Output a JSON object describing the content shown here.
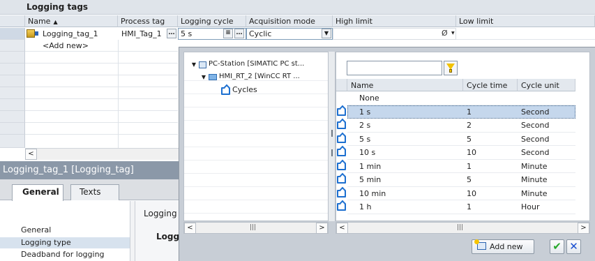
{
  "table": {
    "title": "Logging tags",
    "columns": [
      "Name",
      "Process tag",
      "Logging cycle",
      "Acquisition mode",
      "High limit",
      "Low limit"
    ],
    "rows": [
      {
        "name": "Logging_tag_1",
        "process_tag": "HMI_Tag_1",
        "logging_cycle": "5 s",
        "acquisition_mode": "Cyclic",
        "high_limit": "",
        "low_limit": ""
      }
    ],
    "add_new": "<Add new>",
    "ellipsis_glyph": "…",
    "list_glyph": "≡",
    "dropdown_glyph": "▼",
    "nolimit_glyph": "Ø"
  },
  "properties": {
    "title": "Logging_tag_1 [Logging_tag]",
    "tabs": [
      "General",
      "Texts"
    ],
    "nav": [
      "General",
      "Logging type",
      "Deadband for logging"
    ],
    "selected_nav": "Logging type",
    "content_heading": "Logging",
    "content_subheading": "Loggi"
  },
  "picker": {
    "tree": [
      {
        "label": "PC-Station [SIMATIC PC st...",
        "level": 0
      },
      {
        "label": "HMI_RT_2 [WinCC RT ...",
        "level": 1
      },
      {
        "label": "Cycles",
        "level": 2
      }
    ],
    "filter_value": "",
    "columns": [
      "Name",
      "Cycle time",
      "Cycle unit"
    ],
    "rows": [
      {
        "name": "None",
        "time": "",
        "unit": ""
      },
      {
        "name": "1 s",
        "time": "1",
        "unit": "Second"
      },
      {
        "name": "2 s",
        "time": "2",
        "unit": "Second"
      },
      {
        "name": "5 s",
        "time": "5",
        "unit": "Second"
      },
      {
        "name": "10 s",
        "time": "10",
        "unit": "Second"
      },
      {
        "name": "1 min",
        "time": "1",
        "unit": "Minute"
      },
      {
        "name": "5 min",
        "time": "5",
        "unit": "Minute"
      },
      {
        "name": "10 min",
        "time": "10",
        "unit": "Minute"
      },
      {
        "name": "1 h",
        "time": "1",
        "unit": "Hour"
      }
    ],
    "selected_row": "1 s",
    "add_new_label": "Add new",
    "ok_glyph": "✔",
    "cancel_glyph": "✕",
    "scroll_left_glyph": "<",
    "scroll_right_glyph": ">",
    "scroll_grip_glyph": "|||"
  },
  "colors": {
    "accent": "#1c6fd0",
    "selection": "#c5d7ec",
    "properties_bar": "#8b98a8"
  }
}
